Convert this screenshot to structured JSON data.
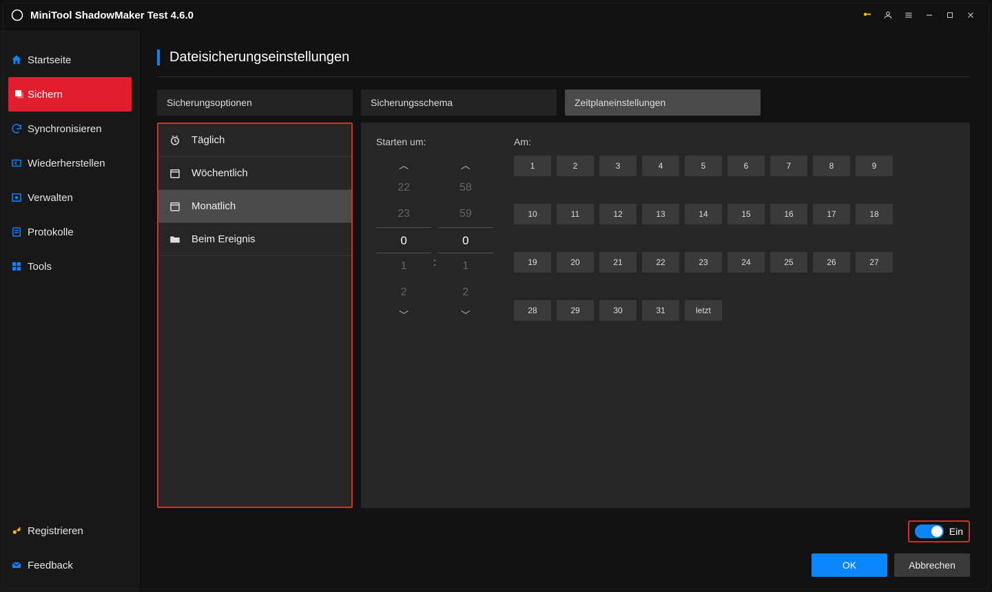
{
  "app": {
    "title": "MiniTool ShadowMaker Test 4.6.0"
  },
  "sidebar": {
    "items": [
      {
        "label": "Startseite"
      },
      {
        "label": "Sichern"
      },
      {
        "label": "Synchronisieren"
      },
      {
        "label": "Wiederherstellen"
      },
      {
        "label": "Verwalten"
      },
      {
        "label": "Protokolle"
      },
      {
        "label": "Tools"
      }
    ],
    "bottom": [
      {
        "label": "Registrieren"
      },
      {
        "label": "Feedback"
      }
    ]
  },
  "page": {
    "title": "Dateisicherungseinstellungen"
  },
  "tabs": {
    "options": "Sicherungsoptionen",
    "scheme": "Sicherungsschema",
    "schedule": "Zeitplaneinstellungen"
  },
  "schedule_types": {
    "daily": "Täglich",
    "weekly": "Wöchentlich",
    "monthly": "Monatlich",
    "on_event": "Beim Ereignis"
  },
  "detail": {
    "start_label": "Starten um:",
    "on_label": "Am:",
    "hours": {
      "m2": "22",
      "m1": "23",
      "sel": "0",
      "p1": "1",
      "p2": "2"
    },
    "minutes": {
      "m2": "58",
      "m1": "59",
      "sel": "0",
      "p1": "1",
      "p2": "2"
    },
    "colon": ":",
    "days_row1": [
      "1",
      "2",
      "3",
      "4",
      "5",
      "6",
      "7",
      "8",
      "9"
    ],
    "days_row2": [
      "10",
      "11",
      "12",
      "13",
      "14",
      "15",
      "16",
      "17",
      "18"
    ],
    "days_row3": [
      "19",
      "20",
      "21",
      "22",
      "23",
      "24",
      "25",
      "26",
      "27"
    ],
    "days_row4": [
      "28",
      "29",
      "30",
      "31",
      "letzt"
    ]
  },
  "footer": {
    "toggle_label": "Ein",
    "ok": "OK",
    "cancel": "Abbrechen"
  }
}
